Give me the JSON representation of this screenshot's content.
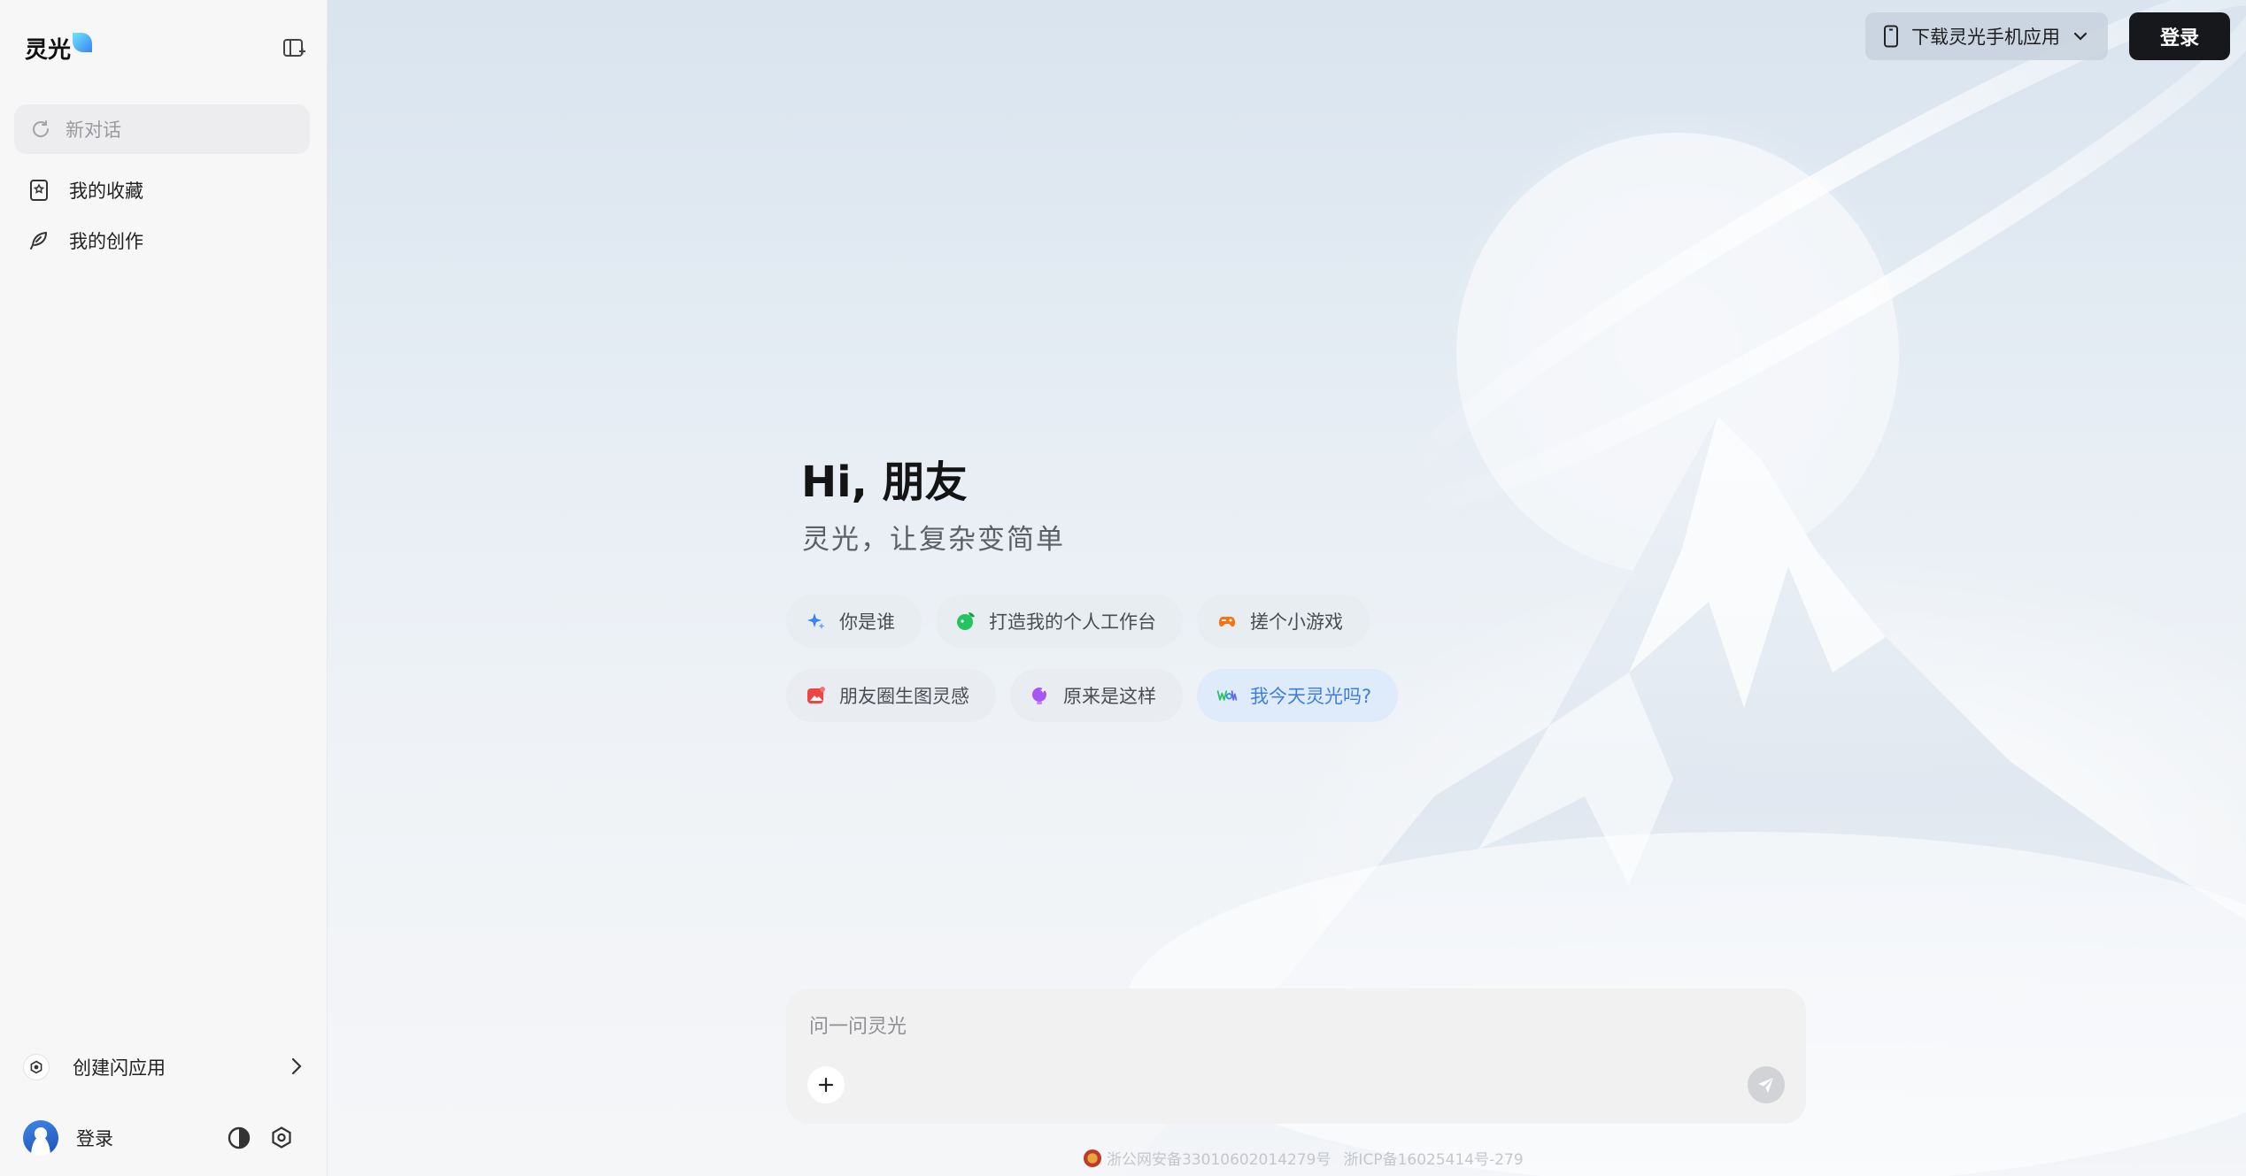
{
  "app": {
    "logo_text": "灵光"
  },
  "sidebar": {
    "new_chat_label": "新对话",
    "items": [
      {
        "label": "我的收藏",
        "icon": "bookmark-icon"
      },
      {
        "label": "我的创作",
        "icon": "feather-icon"
      }
    ],
    "create_app_label": "创建闪应用",
    "user": {
      "login_label": "登录"
    }
  },
  "header": {
    "download_label": "下载灵光手机应用",
    "login_button": "登录"
  },
  "hero": {
    "greeting": "Hi, 朋友",
    "subtitle": "灵光，让复杂变简单"
  },
  "suggestions": {
    "row1": [
      {
        "label": "你是谁",
        "icon": "sparkle-icon",
        "color": "#3b82f6"
      },
      {
        "label": "打造我的个人工作台",
        "icon": "leaf-icon",
        "color": "#22c55e"
      },
      {
        "label": "搓个小游戏",
        "icon": "game-icon",
        "color": "#f97316"
      }
    ],
    "row2": [
      {
        "label": "朋友圈生图灵感",
        "icon": "image-icon",
        "color": "#ef4444"
      },
      {
        "label": "原来是这样",
        "icon": "bulb-icon",
        "color": "#a855f7"
      },
      {
        "label": "我今天灵光吗?",
        "icon": "wow-icon",
        "color": "#3d7ee0"
      }
    ]
  },
  "composer": {
    "placeholder": "问一问灵光"
  },
  "footer": {
    "police_record": "浙公网安备33010602014279号",
    "icp_record": "浙ICP备16025414号-279"
  }
}
